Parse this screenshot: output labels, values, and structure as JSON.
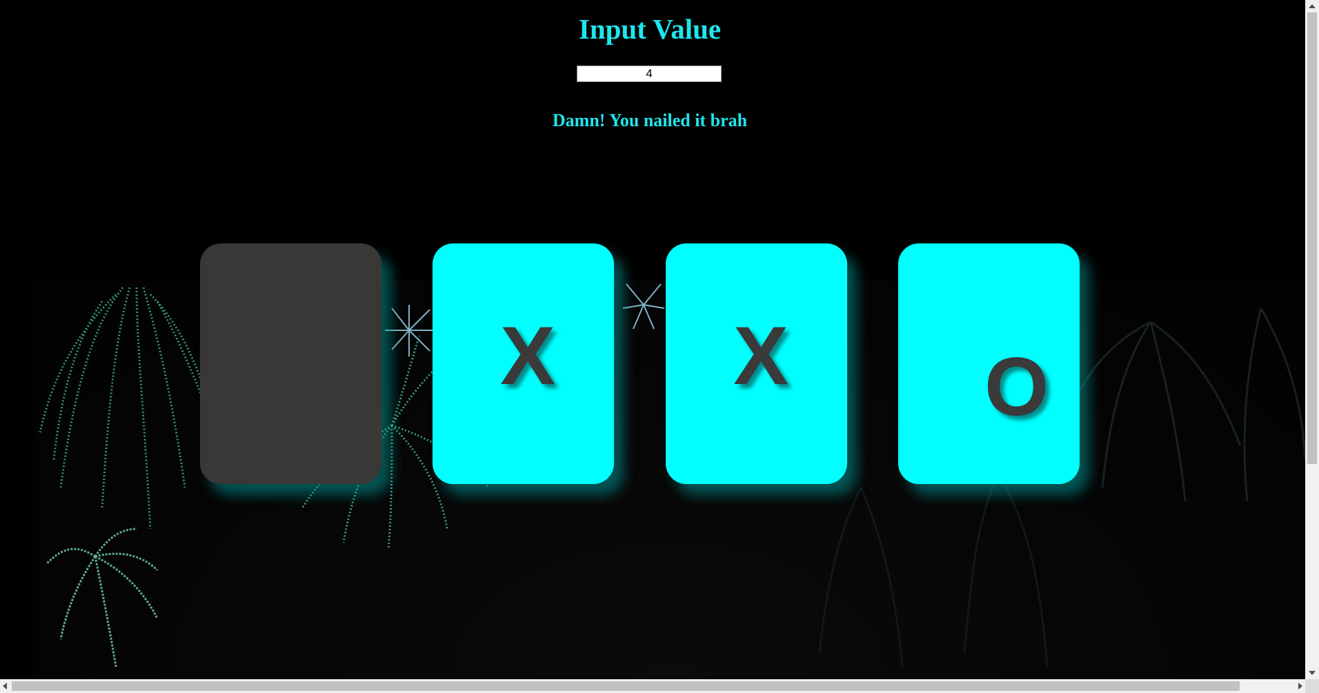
{
  "title": "Input Value",
  "input": {
    "value": "4"
  },
  "message": "Damn! You nailed it brah",
  "cards": [
    {
      "state": "face-down",
      "symbol": ""
    },
    {
      "state": "face-up",
      "symbol": "X"
    },
    {
      "state": "face-up",
      "symbol": "X"
    },
    {
      "state": "face-up",
      "symbol": "O"
    }
  ],
  "colors": {
    "accent": "#1ee6ee",
    "card_face": "#00ffff",
    "card_back": "#3a3836",
    "background": "#000000"
  }
}
